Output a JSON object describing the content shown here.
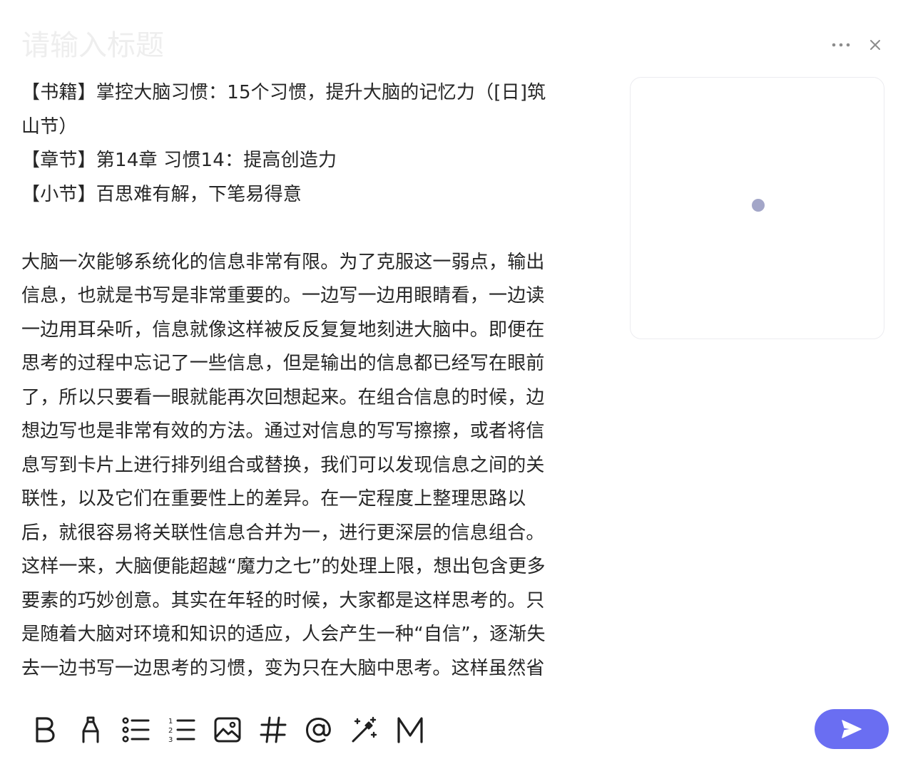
{
  "editor": {
    "title_placeholder": "请输入标题",
    "title_value": ""
  },
  "content": {
    "lines": [
      "【书籍】掌控大脑习惯：15个习惯，提升大脑的记忆力（[日]筑",
      "山节）",
      "【章节】第14章 习惯14：提高创造力",
      "【小节】百思难有解，下笔易得意"
    ],
    "body_lines": [
      "大脑一次能够系统化的信息非常有限。为了克服这一弱点，输出",
      "信息，也就是书写是非常重要的。一边写一边用眼睛看，一边读",
      "一边用耳朵听，信息就像这样被反反复复地刻进大脑中。即便在",
      "思考的过程中忘记了一些信息，但是输出的信息都已经写在眼前",
      "了，所以只要看一眼就能再次回想起来。在组合信息的时候，边",
      "想边写也是非常有效的方法。通过对信息的写写擦擦，或者将信",
      "息写到卡片上进行排列组合或替换，我们可以发现信息之间的关",
      "联性，以及它们在重要性上的差异。在一定程度上整理思路以",
      "后，就很容易将关联性信息合并为一，进行更深层的信息组合。",
      "这样一来，大脑便能超越“魔力之七”的处理上限，想出包含更多",
      "要素的巧妙创意。其实在年轻的时候，大家都是这样思考的。只",
      "是随着大脑对环境和知识的适应，人会产生一种“自信”，逐渐失",
      "去一边书写一边思考的习惯，变为只在大脑中思考。这样虽然省"
    ]
  },
  "top_actions": [
    {
      "name": "more-icon"
    },
    {
      "name": "close-icon"
    }
  ],
  "toolbar": {
    "tools": [
      "bold-icon",
      "highlight-icon",
      "bullet-list-icon",
      "numbered-list-icon",
      "image-icon",
      "hashtag-icon",
      "mention-icon",
      "magic-wand-icon",
      "markdown-icon"
    ]
  },
  "colors": {
    "accent": "#6a6ef2",
    "loading_dot": "#a3a6c8",
    "text": "#262626",
    "card_border": "#ececf0"
  }
}
